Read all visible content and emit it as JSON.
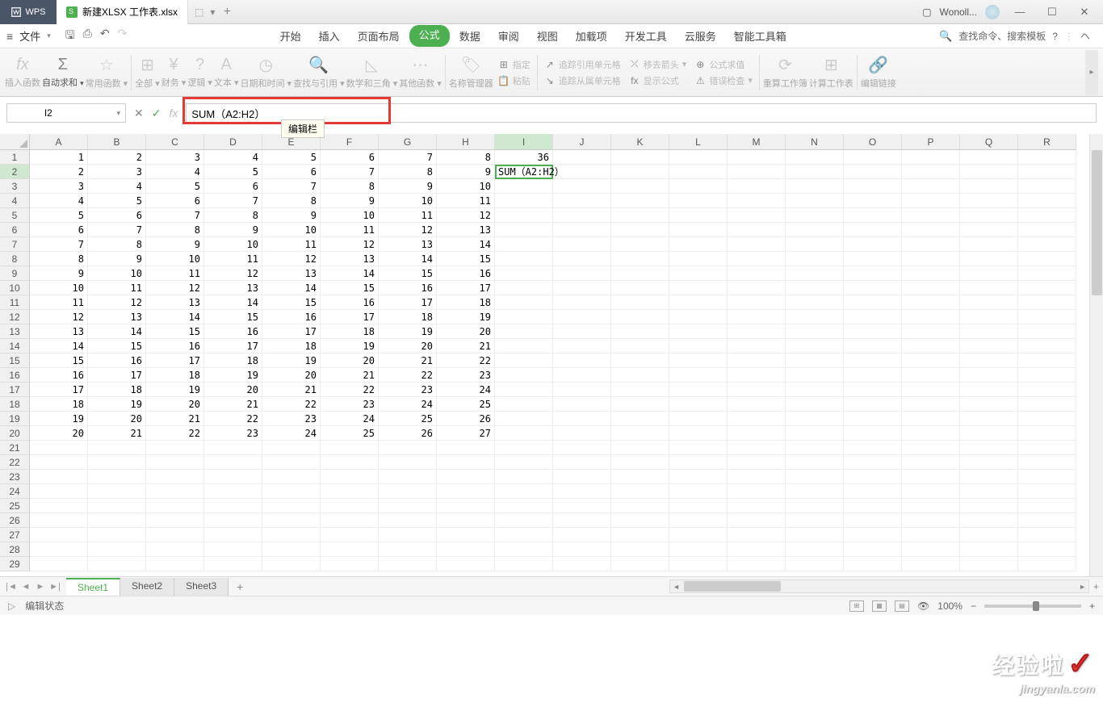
{
  "title_bar": {
    "app_name": "WPS",
    "file_tab": "新建XLSX 工作表.xlsx",
    "user": "Wonoll...",
    "window_square": "▢"
  },
  "menu": {
    "file": "文件",
    "tabs": [
      "开始",
      "插入",
      "页面布局",
      "公式",
      "数据",
      "审阅",
      "视图",
      "加载项",
      "开发工具",
      "云服务",
      "智能工具箱"
    ],
    "active_tab_index": 3,
    "search_placeholder": "查找命令、搜索模板"
  },
  "ribbon": {
    "insert_fn": "插入函数",
    "autosum": "自动求和",
    "common_fn": "常用函数",
    "all": "全部",
    "finance": "财务",
    "logic": "逻辑",
    "text": "文本",
    "datetime": "日期和时间",
    "lookup": "查找与引用",
    "math": "数学和三角",
    "other": "其他函数",
    "name_mgr": "名称管理器",
    "assign": "指定",
    "paste": "粘贴",
    "trace_precedents": "追踪引用单元格",
    "trace_dependents": "追踪从属单元格",
    "remove_arrows": "移去箭头",
    "show_formula": "显示公式",
    "evaluate": "公式求值",
    "error_check": "错误检查",
    "recalc_wb": "重算工作簿",
    "calc_ws": "计算工作表",
    "edit_link": "编辑链接"
  },
  "formula_bar": {
    "name_box": "I2",
    "formula": "SUM（A2:H2）",
    "tooltip": "编辑栏"
  },
  "columns": [
    "A",
    "B",
    "C",
    "D",
    "E",
    "F",
    "G",
    "H",
    "I",
    "J",
    "K",
    "L",
    "M",
    "N",
    "O",
    "P",
    "Q",
    "R"
  ],
  "rows": 29,
  "active_col_index": 8,
  "active_row_index": 1,
  "cell_formula_display": "SUM（A2:H2）",
  "grid": [
    [
      1,
      2,
      3,
      4,
      5,
      6,
      7,
      8,
      36
    ],
    [
      2,
      3,
      4,
      5,
      6,
      7,
      8,
      9,
      null
    ],
    [
      3,
      4,
      5,
      6,
      7,
      8,
      9,
      10,
      null
    ],
    [
      4,
      5,
      6,
      7,
      8,
      9,
      10,
      11,
      null
    ],
    [
      5,
      6,
      7,
      8,
      9,
      10,
      11,
      12,
      null
    ],
    [
      6,
      7,
      8,
      9,
      10,
      11,
      12,
      13,
      null
    ],
    [
      7,
      8,
      9,
      10,
      11,
      12,
      13,
      14,
      null
    ],
    [
      8,
      9,
      10,
      11,
      12,
      13,
      14,
      15,
      null
    ],
    [
      9,
      10,
      11,
      12,
      13,
      14,
      15,
      16,
      null
    ],
    [
      10,
      11,
      12,
      13,
      14,
      15,
      16,
      17,
      null
    ],
    [
      11,
      12,
      13,
      14,
      15,
      16,
      17,
      18,
      null
    ],
    [
      12,
      13,
      14,
      15,
      16,
      17,
      18,
      19,
      null
    ],
    [
      13,
      14,
      15,
      16,
      17,
      18,
      19,
      20,
      null
    ],
    [
      14,
      15,
      16,
      17,
      18,
      19,
      20,
      21,
      null
    ],
    [
      15,
      16,
      17,
      18,
      19,
      20,
      21,
      22,
      null
    ],
    [
      16,
      17,
      18,
      19,
      20,
      21,
      22,
      23,
      null
    ],
    [
      17,
      18,
      19,
      20,
      21,
      22,
      23,
      24,
      null
    ],
    [
      18,
      19,
      20,
      21,
      22,
      23,
      24,
      25,
      null
    ],
    [
      19,
      20,
      21,
      22,
      23,
      24,
      25,
      26,
      null
    ],
    [
      20,
      21,
      22,
      23,
      24,
      25,
      26,
      27,
      null
    ]
  ],
  "sheets": {
    "tabs": [
      "Sheet1",
      "Sheet2",
      "Sheet3"
    ],
    "active": 0
  },
  "status": {
    "mode": "编辑状态",
    "zoom": "100%"
  },
  "watermark": {
    "main": "经验啦",
    "sub": "jingyanla.com"
  }
}
